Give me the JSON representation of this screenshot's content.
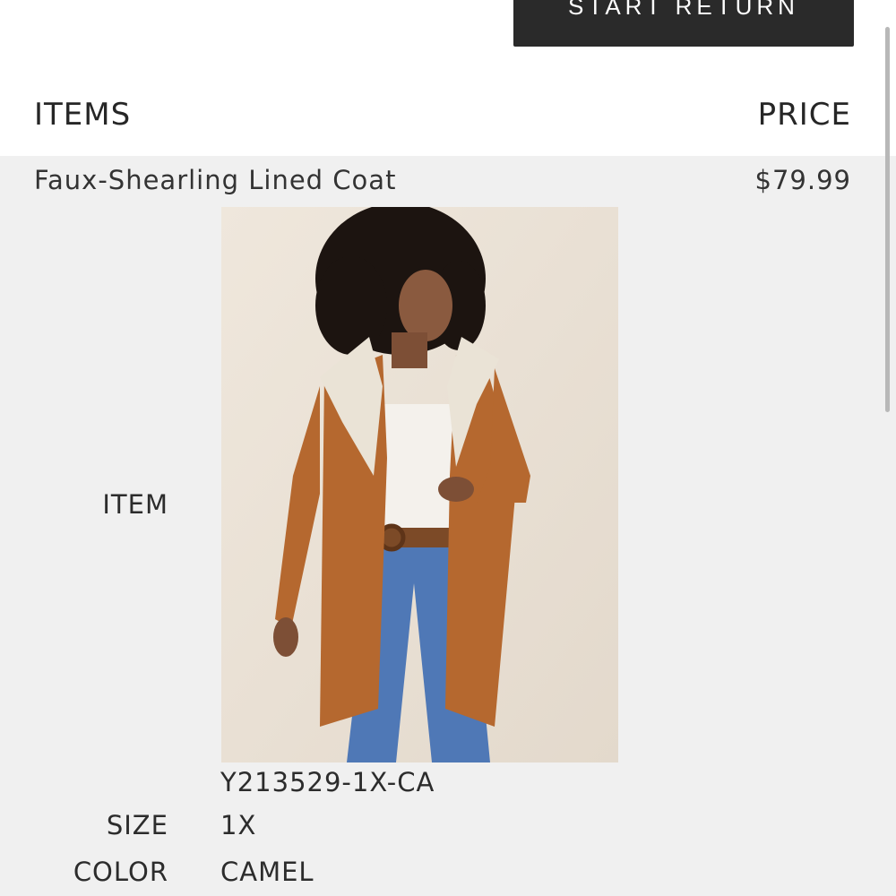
{
  "actions": {
    "start_return_label": "START RETURN"
  },
  "table_header": {
    "items_label": "ITEMS",
    "price_label": "PRICE"
  },
  "item": {
    "name": "Faux-Shearling Lined Coat",
    "price": "$79.99",
    "item_label": "ITEM",
    "sku": "Y213529-1X-CA",
    "size_label": "SIZE",
    "size_value": "1X",
    "color_label": "COLOR",
    "color_value": "CAMEL",
    "image_alt": "product-photo"
  },
  "colors": {
    "button_bg": "#2a2a2a",
    "row_bg": "#f0f0f0",
    "coat_camel": "#b5682f",
    "jeans": "#4f78b6"
  }
}
